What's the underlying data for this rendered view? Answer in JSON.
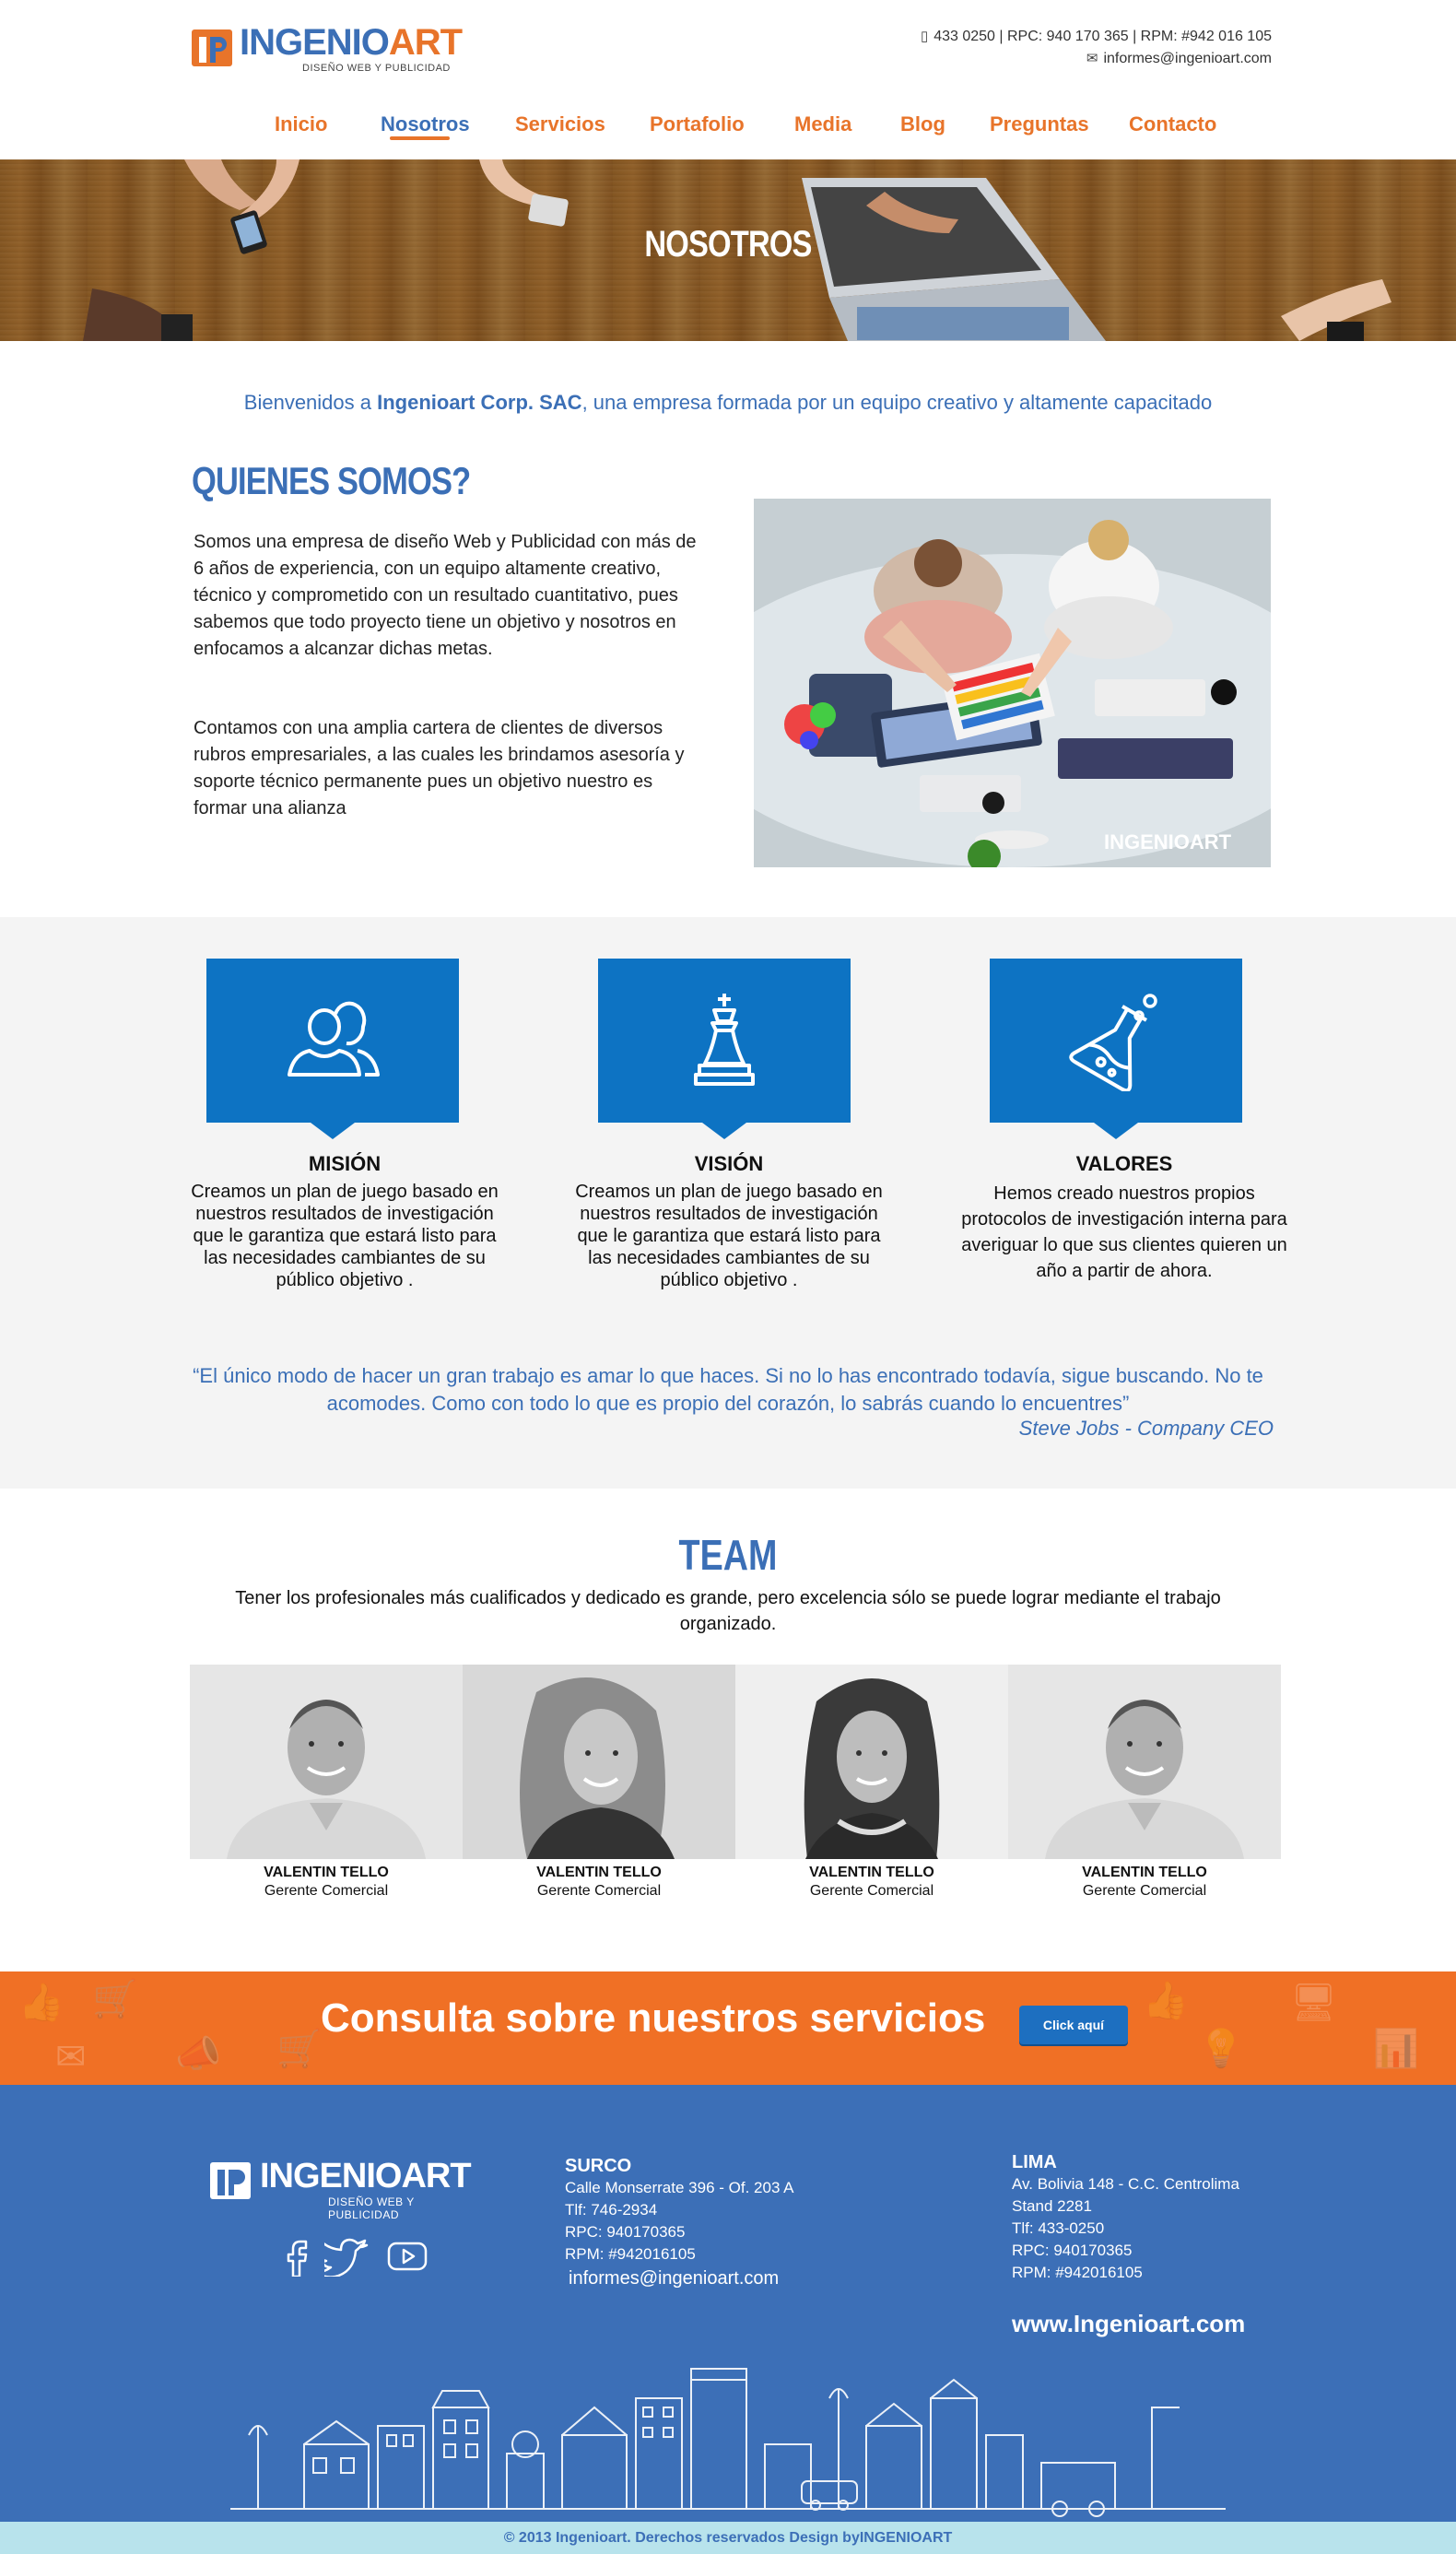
{
  "header": {
    "logo_text_1": "INGENIO",
    "logo_text_2": "ART",
    "logo_tagline": "DISEÑO WEB Y PUBLICIDAD",
    "phones": "433 0250 | RPC: 940 170 365 | RPM: #942 016 105",
    "email": "informes@ingenioart.com",
    "phone_icon": "mobile-phone-icon",
    "mail_icon": "envelope-icon"
  },
  "nav": {
    "items": [
      {
        "label": "Inicio"
      },
      {
        "label": "Nosotros"
      },
      {
        "label": "Servicios"
      },
      {
        "label": "Portafolio"
      },
      {
        "label": "Media"
      },
      {
        "label": "Blog"
      },
      {
        "label": "Preguntas"
      },
      {
        "label": "Contacto"
      }
    ],
    "active": "Nosotros"
  },
  "hero": {
    "title": "NOSOTROS"
  },
  "intro": {
    "prefix": "Bienvenidos a ",
    "company": "Ingenioart Corp. SAC",
    "suffix": ", una empresa formada por un equipo creativo y altamente capacitado"
  },
  "about": {
    "title": "QUIENES SOMOS?",
    "p1": "Somos una empresa de diseño Web y Publicidad con más de 6 años de experiencia, con un equipo altamente creativo, técnico y comprometido con un resultado cuantitativo, pues sabemos que todo proyecto tiene un objetivo y nosotros en enfocamos a alcanzar dichas metas.",
    "p2": "Contamos con una amplia cartera de clientes de diversos rubros empresariales, a las cuales les brindamos asesoría y soporte técnico permanente pues un objetivo nuestro es formar una alianza",
    "photo_watermark": "INGENIOART"
  },
  "features": [
    {
      "title": "MISIÓN",
      "text": "Creamos un plan de juego basado en nuestros resultados de investigación que le garantiza que estará listo para las necesidades cambiantes de su público objetivo .",
      "icon": "people-icon"
    },
    {
      "title": "VISIÓN",
      "text": "Creamos un plan de juego basado en nuestros resultados de investigación que le garantiza que estará listo para las necesidades cambiantes de su público objetivo .",
      "icon": "chess-king-icon"
    },
    {
      "title": "VALORES",
      "text": "Hemos creado nuestros propios protocolos de investigación interna para averiguar lo que sus clientes quieren un año a partir de ahora.",
      "icon": "flask-icon"
    }
  ],
  "quote": {
    "text": "“El único modo de hacer un gran trabajo es amar lo que haces. Si no lo has encontrado todavía, sigue buscando. No te acomodes. Como con todo lo que es propio del corazón, lo sabrás cuando lo encuentres”",
    "author": "Steve Jobs - Company CEO"
  },
  "team": {
    "title": "TEAM",
    "subtitle": "Tener los profesionales más cualificados y dedicado es grande, pero excelencia sólo se puede lograr mediante el trabajo organizado.",
    "members": [
      {
        "name": "VALENTIN TELLO",
        "role": "Gerente Comercial"
      },
      {
        "name": "VALENTIN TELLO",
        "role": "Gerente Comercial"
      },
      {
        "name": "VALENTIN TELLO",
        "role": "Gerente Comercial"
      },
      {
        "name": "VALENTIN TELLO",
        "role": "Gerente Comercial"
      }
    ]
  },
  "cta": {
    "text": "Consulta sobre nuestros servicios",
    "button": "Click aquí"
  },
  "footer": {
    "logo_text": "INGENIOART",
    "logo_tagline": "DISEÑO WEB Y PUBLICIDAD",
    "social": [
      "facebook-icon",
      "twitter-icon",
      "youtube-icon"
    ],
    "surco": {
      "heading": "SURCO",
      "address": "Calle Monserrate 396 - Of. 203 A",
      "tlf": "Tlf: 746-2934",
      "rpc": "RPC: 940170365",
      "rpm": "RPM: #942016105",
      "email": "informes@ingenioart.com"
    },
    "lima": {
      "heading": "LIMA",
      "address1": "Av. Bolivia 148 - C.C. Centrolima",
      "address2": "Stand 2281",
      "tlf": "Tlf: 433-0250",
      "rpc": "RPC: 940170365",
      "rpm": "RPM: #942016105"
    },
    "website": "www.Ingenioart.com",
    "copyright": "© 2013 Ingenioart. Derechos reservados Design byINGENIOART"
  },
  "colors": {
    "brand_blue": "#3b6fb6",
    "brand_orange": "#e8742a",
    "feature_blue": "#0d73c3",
    "footer_blue": "#3c6fb7",
    "copyright_bg": "#b8e3ec"
  }
}
